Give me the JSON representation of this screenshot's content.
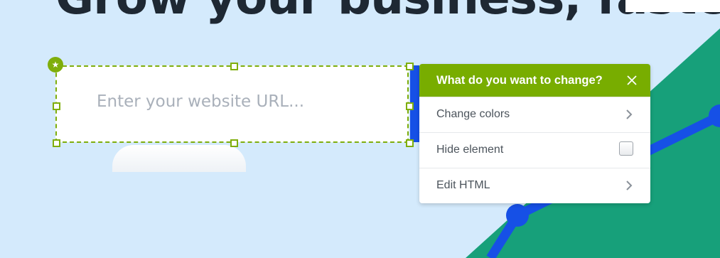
{
  "headline": {
    "text": "Grow your business, faste"
  },
  "url_form": {
    "placeholder": "Enter your website URL..."
  },
  "selection": {
    "badge_icon": "star-icon"
  },
  "popup": {
    "title": "What do you want to change?",
    "close_icon": "close-icon",
    "items": [
      {
        "label": "Change colors",
        "control": "chevron-right-icon"
      },
      {
        "label": "Hide element",
        "control": "checkbox",
        "checked": false
      },
      {
        "label": "Edit HTML",
        "control": "chevron-right-icon"
      }
    ]
  },
  "colors": {
    "page_bg": "#d4eafc",
    "accent_green": "#78ad00",
    "selection_green": "#7fae0b",
    "chart_teal": "#17a07a",
    "chart_blue": "#1650e6",
    "headline": "#1e2833"
  }
}
